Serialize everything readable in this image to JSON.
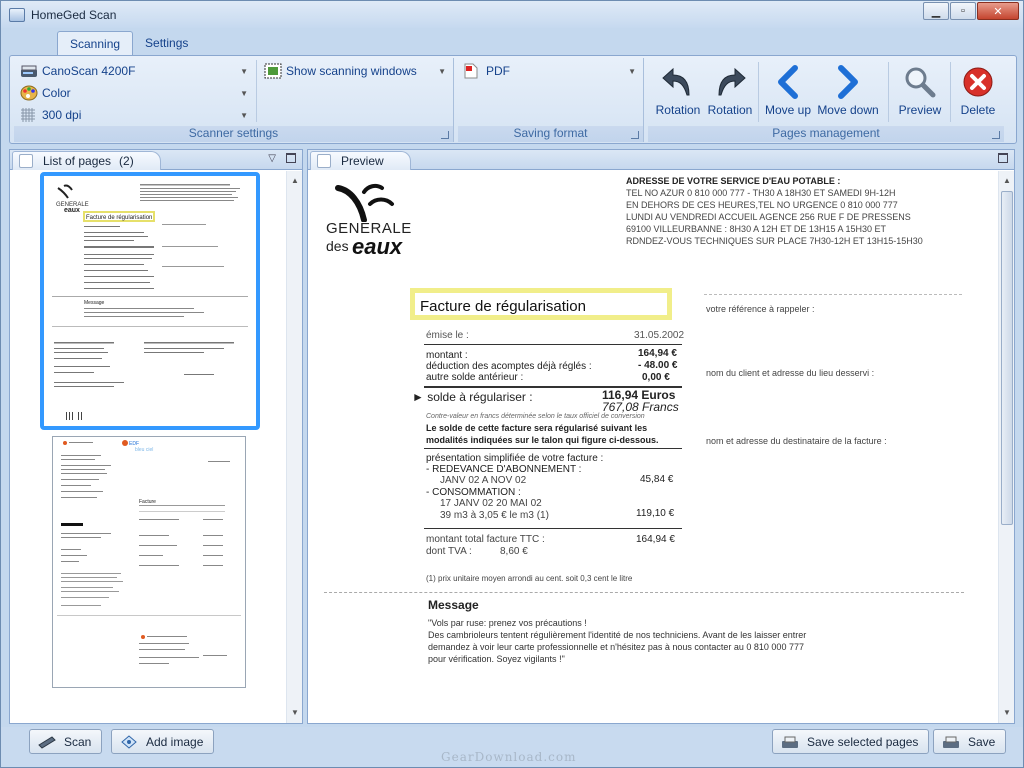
{
  "window": {
    "title": "HomeGed Scan",
    "controls": {
      "minimize": "▁",
      "maximize": "▫",
      "close": "✕"
    }
  },
  "ribbon": {
    "tabs": [
      {
        "label": "Scanning",
        "active": true
      },
      {
        "label": "Settings",
        "active": false
      }
    ],
    "scanner_settings": {
      "label": "Scanner settings",
      "scanner": "CanoScan 4200F",
      "color_mode": "Color",
      "resolution": "300 dpi",
      "show_windows": "Show scanning windows"
    },
    "saving_format": {
      "label": "Saving format",
      "format": "PDF"
    },
    "pages_management": {
      "label": "Pages management",
      "buttons": [
        "Rotation",
        "Rotation",
        "Move up",
        "Move down",
        "Preview",
        "Delete"
      ]
    }
  },
  "list_panel": {
    "title": "List of pages",
    "count": "(2)",
    "pages": [
      {
        "page": 1,
        "selected": true
      },
      {
        "page": 2,
        "selected": false
      }
    ]
  },
  "preview_panel": {
    "title": "Preview",
    "document": {
      "logo_line1": "GENERALE",
      "logo_line2": "des",
      "logo_line3": "eaux",
      "header_lines": [
        "ADRESSE DE VOTRE SERVICE D'EAU POTABLE :",
        "TEL NO AZUR 0 810 000 777 - TH30 A 18H30 ET SAMEDI 9H-12H",
        "EN DEHORS DE CES HEURES,TEL NO URGENCE 0 810 000 777",
        "LUNDI AU VENDREDI ACCUEIL AGENCE 256 RUE F DE PRESSENS",
        "69100 VILLEURBANNE : 8H30 A 12H ET DE 13H15 A 15H30 ET",
        "RDNDEZ-VOUS TECHNIQUES SUR PLACE 7H30-12H ET 13H15-15H30"
      ],
      "invoice_title": "Facture de régularisation",
      "emise_label": "émise le :",
      "emise_date": "31.05.2002",
      "rows": [
        {
          "label": "montant :",
          "value": "164,94 €"
        },
        {
          "label": "déduction des acomptes déjà réglés :",
          "value": "- 48.00 €"
        },
        {
          "label": "autre solde antérieur :",
          "value": "0,00 €"
        }
      ],
      "solde_label": "► solde à régulariser :",
      "solde_euros": "116,94 Euros",
      "solde_francs": "767,08 Francs",
      "conversion_note": "Contre-valeur en francs déterminée selon le taux officiel de conversion",
      "reg_line1": "Le solde de cette facture sera régularisé suivant les",
      "reg_line2": "modalités indiquées sur le talon qui figure ci-dessous.",
      "presentation": "présentation simplifiée de votre facture :",
      "redevance": "- REDEVANCE D'ABONNEMENT :",
      "redevance_period": "JANV 02 A NOV 02",
      "redevance_value": "45,84 €",
      "consommation": "- CONSOMMATION :",
      "conso_period": "17 JANV 02 20 MAI 02",
      "conso_detail": "39 m3 à 3,05 € le m3   (1)",
      "conso_value": "119,10 €",
      "total_label": "montant total facture TTC :",
      "total_value": "164,94 €",
      "tva_label": "dont TVA :",
      "tva_value": "8,60 €",
      "footnote": "(1) prix unitaire moyen arrondi au cent. soit 0,3 cent le litre",
      "ref_label": "votre référence à rappeler :",
      "client_label": "nom du client et adresse du lieu desservi :",
      "dest_label": "nom et adresse du destinataire de la facture :",
      "message_title": "Message",
      "message_lines": [
        "\"Vols par ruse: prenez vos précautions !",
        "Des cambrioleurs tentent régulièrement l'identité de nos techniciens. Avant de les laisser entrer",
        "demandez à voir leur carte professionnelle et n'hésitez pas à nous contacter au 0 810 000 777",
        "pour vérification. Soyez vigilants !\""
      ]
    }
  },
  "footer": {
    "scan": "Scan",
    "add_image": "Add image",
    "save_selected": "Save selected pages",
    "save": "Save",
    "watermark": "GearDownload.com"
  }
}
